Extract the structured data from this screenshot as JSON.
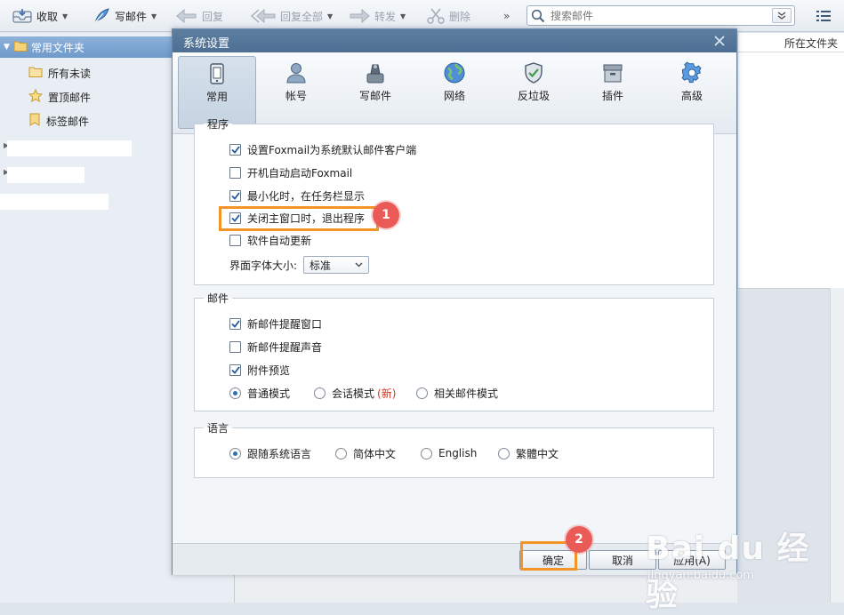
{
  "toolbar": {
    "receive": "收取",
    "compose": "写邮件",
    "reply": "回复",
    "reply_all": "回复全部",
    "forward": "转发",
    "delete": "删除",
    "more": "»",
    "search_placeholder": "搜索邮件"
  },
  "sidebar": {
    "header": "常用文件夹",
    "items": [
      {
        "label": "所有未读",
        "icon": "folder-icon"
      },
      {
        "label": "置顶邮件",
        "icon": "star-icon"
      },
      {
        "label": "标签邮件",
        "icon": "tag-icon"
      }
    ]
  },
  "list": {
    "column_folder": "所在文件夹"
  },
  "dialog": {
    "title": "系统设置",
    "categories": [
      {
        "label": "常用",
        "icon": "phone-icon",
        "active": true
      },
      {
        "label": "帐号",
        "icon": "user-icon"
      },
      {
        "label": "写邮件",
        "icon": "pen-icon"
      },
      {
        "label": "网络",
        "icon": "globe-icon"
      },
      {
        "label": "反垃圾",
        "icon": "shield-icon"
      },
      {
        "label": "插件",
        "icon": "box-icon"
      },
      {
        "label": "高级",
        "icon": "gear-icon"
      }
    ],
    "program": {
      "legend": "程序",
      "options": [
        {
          "label": "设置Foxmail为系统默认邮件客户端",
          "checked": true
        },
        {
          "label": "开机自动启动Foxmail",
          "checked": false
        },
        {
          "label": "最小化时，在任务栏显示",
          "checked": true
        },
        {
          "label": "关闭主窗口时，退出程序",
          "checked": true
        },
        {
          "label": "软件自动更新",
          "checked": false
        }
      ],
      "font_size_label": "界面字体大小:",
      "font_size_value": "标准"
    },
    "mail": {
      "legend": "邮件",
      "options": [
        {
          "label": "新邮件提醒窗口",
          "checked": true
        },
        {
          "label": "新邮件提醒声音",
          "checked": false
        },
        {
          "label": "附件预览",
          "checked": true
        }
      ],
      "modes": {
        "normal": "普通模式",
        "conversation": "会话模式",
        "new_tag": "(新)",
        "related": "相关邮件模式",
        "selected": "normal"
      }
    },
    "language": {
      "legend": "语言",
      "options": [
        "跟随系统语言",
        "简体中文",
        "English",
        "繁體中文"
      ],
      "selected": 0
    },
    "buttons": {
      "ok": "确定",
      "cancel": "取消",
      "apply": "应用(A)"
    }
  },
  "annotations": {
    "step1": "1",
    "step2": "2"
  },
  "watermark": {
    "logo": "Bai du 经验",
    "url": "jingyan.baidu.com"
  },
  "colors": {
    "highlight": "#f39427",
    "marker": "#ea5b58",
    "accent": "#2f6fb4",
    "title_bar": "#5d7e9f"
  }
}
